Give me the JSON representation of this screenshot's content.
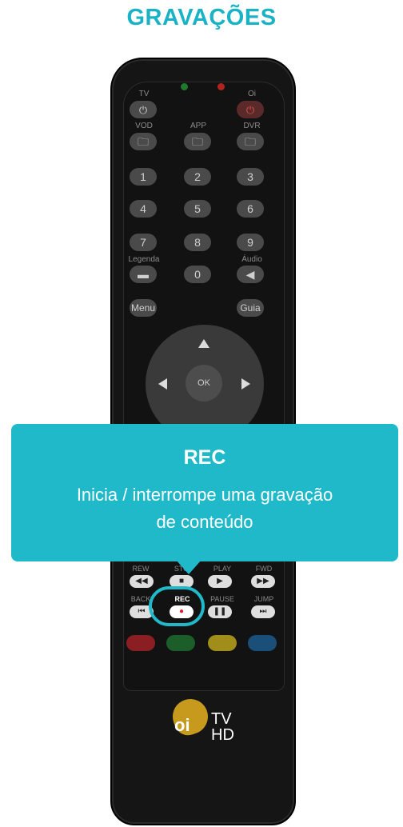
{
  "page": {
    "title": "GRAVAÇÕES"
  },
  "remote": {
    "top_labels": {
      "tv": "TV",
      "oi": "Oi"
    },
    "row_labels": {
      "vod": "VOD",
      "app": "APP",
      "dvr": "DVR"
    },
    "digits": [
      "1",
      "2",
      "3",
      "4",
      "5",
      "6",
      "7",
      "8",
      "9",
      "0"
    ],
    "legenda_label": "Legenda",
    "audio_label": "Áudio",
    "menu_label": "Menu",
    "guia_label": "Guia",
    "ok_label": "OK",
    "transport_labels": {
      "rew": "REW",
      "stop": "STOP",
      "play": "PLAY",
      "fwd": "FWD",
      "back": "BACK",
      "rec": "REC",
      "pause": "PAUSE",
      "jump": "JUMP"
    },
    "logo": {
      "brand": "oi",
      "tv": "TV",
      "hd": "HD"
    },
    "colors": {
      "body": "#151515",
      "button": "#4a4a4a",
      "accent": "#20b9c9",
      "red_led": "#b1231f",
      "green_led": "#1f7a2b"
    }
  },
  "tooltip": {
    "title": "REC",
    "description_line1": "Inicia / interrompe uma gravação",
    "description_line2": "de conteúdo"
  }
}
